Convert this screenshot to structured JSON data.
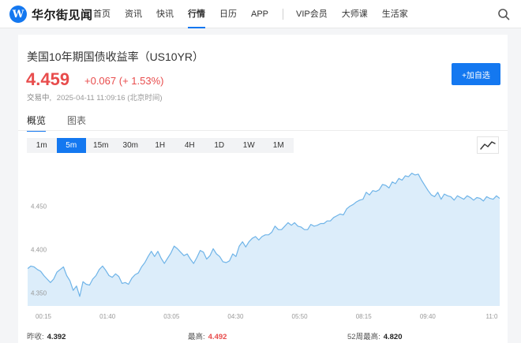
{
  "brand": {
    "logo_letter": "W",
    "name": "华尔街见闻"
  },
  "nav": {
    "items": [
      {
        "label": "首页"
      },
      {
        "label": "资讯"
      },
      {
        "label": "快讯"
      },
      {
        "label": "行情",
        "active": true
      },
      {
        "label": "日历"
      },
      {
        "label": "APP"
      }
    ],
    "extra_items": [
      {
        "label": "VIP会员"
      },
      {
        "label": "大师课"
      },
      {
        "label": "生活家"
      }
    ],
    "search_icon": "search-icon"
  },
  "quote": {
    "title": "美国10年期国债收益率（US10YR）",
    "price": "4.459",
    "change": "+0.067 (+ 1.53%)",
    "status": "交易中,",
    "timestamp": "2025-04-11 11:09:16 (北京时间)",
    "add_button": "+加自选",
    "up_color": "#e84c4c",
    "accent_color": "#1478f0"
  },
  "tabs": [
    {
      "label": "概览",
      "active": true
    },
    {
      "label": "图表"
    }
  ],
  "periods": [
    {
      "label": "1m"
    },
    {
      "label": "5m",
      "active": true
    },
    {
      "label": "15m"
    },
    {
      "label": "30m"
    },
    {
      "label": "1H"
    },
    {
      "label": "4H"
    },
    {
      "label": "1D"
    },
    {
      "label": "1W"
    },
    {
      "label": "1M"
    }
  ],
  "chart_type_icon": "line-chart-icon",
  "stats": {
    "prev_close_label": "昨收:",
    "prev_close": "4.392",
    "high_label": "最高:",
    "high": "4.492",
    "wk52_high_label": "52周最高:",
    "wk52_high": "4.820"
  },
  "chart_data": {
    "type": "area",
    "title": "",
    "xlabel": "",
    "ylabel": "",
    "x_ticks": [
      "00:15",
      "01:40",
      "03:05",
      "04:30",
      "05:50",
      "08:15",
      "09:40",
      "11:0"
    ],
    "y_ticks": [
      "4.450",
      "4.400",
      "4.350"
    ],
    "ylim": [
      4.335,
      4.495
    ],
    "grid": false,
    "line_color": "#6fb4e8",
    "fill_color": "#dcedfa",
    "series": [
      {
        "values": [
          4.378,
          4.381,
          4.38,
          4.377,
          4.375,
          4.37,
          4.366,
          4.362,
          4.366,
          4.374,
          4.377,
          4.38,
          4.37,
          4.364,
          4.353,
          4.358,
          4.346,
          4.363,
          4.36,
          4.359,
          4.366,
          4.37,
          4.377,
          4.381,
          4.376,
          4.37,
          4.368,
          4.372,
          4.369,
          4.361,
          4.362,
          4.36,
          4.367,
          4.371,
          4.373,
          4.38,
          4.385,
          4.392,
          4.398,
          4.392,
          4.398,
          4.39,
          4.384,
          4.39,
          4.396,
          4.404,
          4.401,
          4.397,
          4.393,
          4.395,
          4.389,
          4.384,
          4.391,
          4.399,
          4.397,
          4.389,
          4.393,
          4.401,
          4.395,
          4.392,
          4.386,
          4.385,
          4.387,
          4.395,
          4.392,
          4.404,
          4.409,
          4.403,
          4.409,
          4.413,
          4.415,
          4.411,
          4.415,
          4.417,
          4.417,
          4.42,
          4.427,
          4.423,
          4.423,
          4.427,
          4.431,
          4.428,
          4.431,
          4.427,
          4.426,
          4.423,
          4.423,
          4.429,
          4.427,
          4.428,
          4.43,
          4.43,
          4.433,
          4.433,
          4.437,
          4.439,
          4.441,
          4.44,
          4.447,
          4.45,
          4.452,
          4.455,
          4.457,
          4.458,
          4.466,
          4.463,
          4.468,
          4.467,
          4.469,
          4.475,
          4.474,
          4.471,
          4.478,
          4.476,
          4.482,
          4.48,
          4.485,
          4.484,
          4.488,
          4.486,
          4.487,
          4.48,
          4.474,
          4.468,
          4.463,
          4.461,
          4.466,
          4.458,
          4.464,
          4.462,
          4.461,
          4.457,
          4.462,
          4.46,
          4.458,
          4.462,
          4.46,
          4.457,
          4.46,
          4.459,
          4.456,
          4.461,
          4.459,
          4.458,
          4.462,
          4.459
        ]
      }
    ]
  }
}
